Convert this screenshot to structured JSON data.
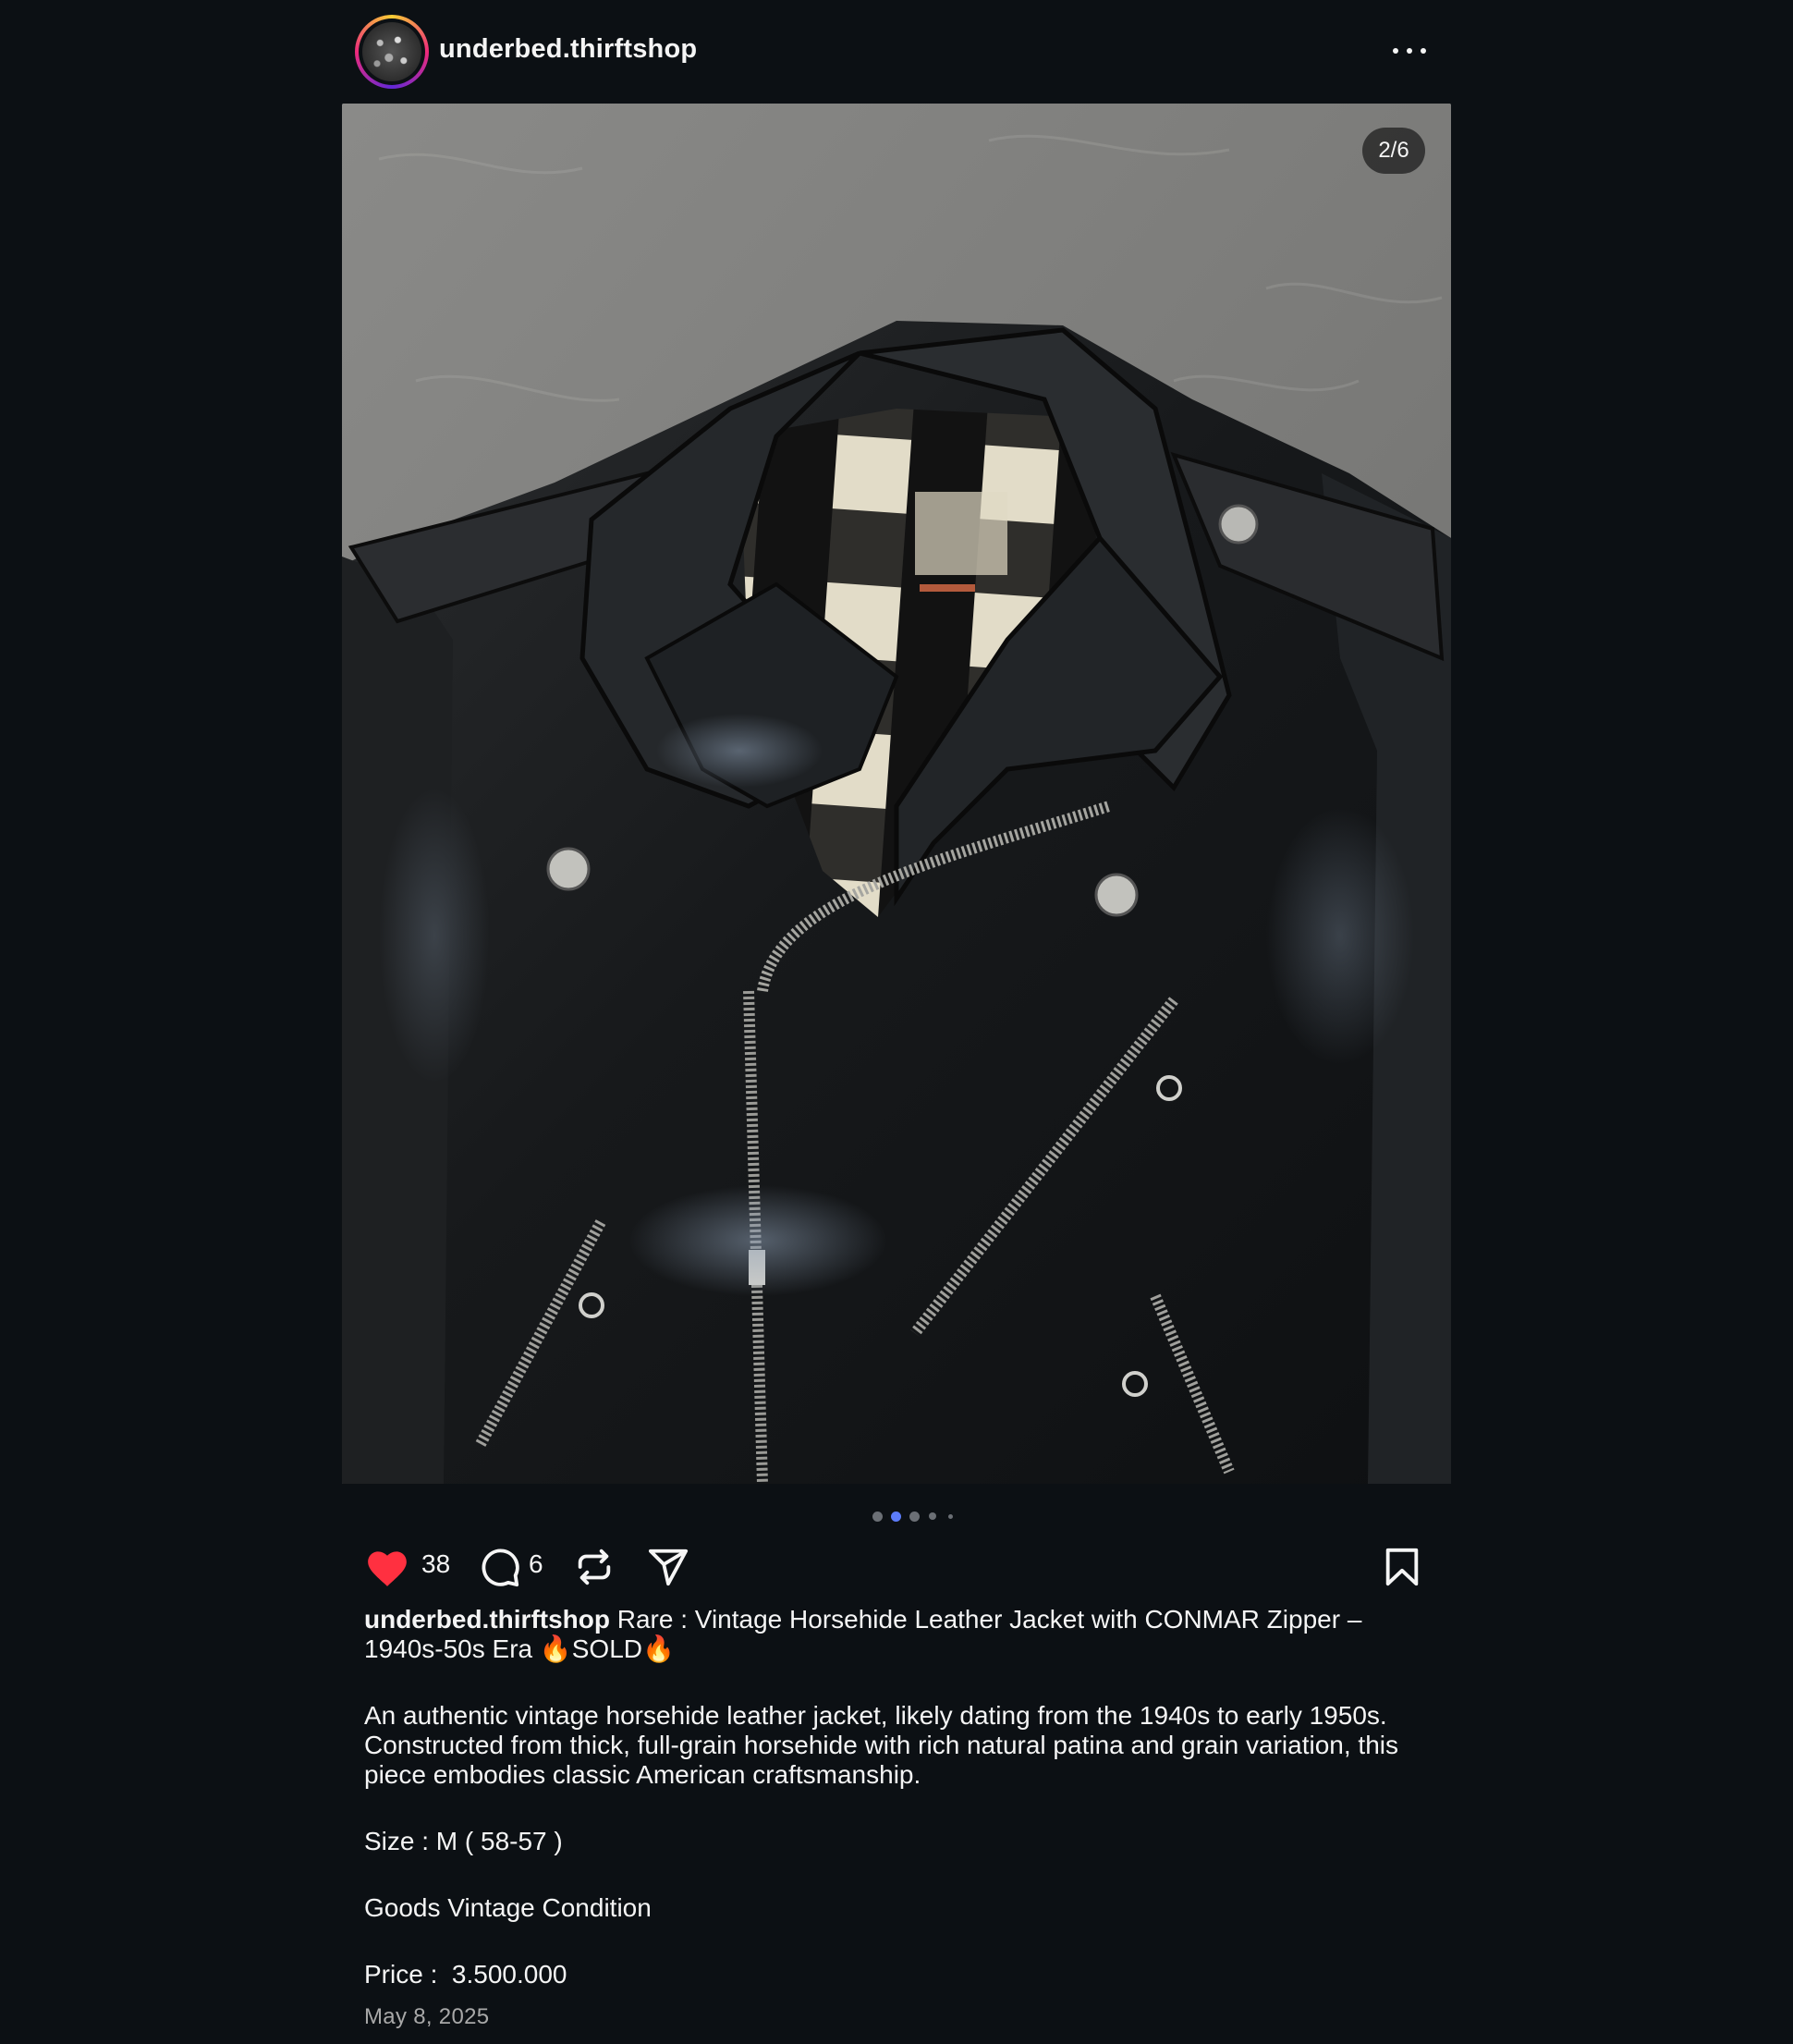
{
  "post": {
    "username": "underbed.thirftshop",
    "more_icon": "more-horizontal-icon",
    "media_counter": "2/6",
    "carousel": {
      "count": 5,
      "active_index": 1
    },
    "likes": "38",
    "comments": "6",
    "liked": true,
    "colors": {
      "like": "#ff3040",
      "active_dot": "#5c7cfa",
      "background": "#0c1014"
    },
    "caption": {
      "author": "underbed.thirftshop",
      "title": "Rare : Vintage Horsehide Leather Jacket with CONMAR Zipper – 1940s-50s Era 🔥SOLD🔥",
      "description": "An authentic vintage horsehide leather jacket, likely dating from the 1940s to early 1950s. Constructed from thick, full-grain horsehide with rich natural patina and grain variation, this piece embodies classic American craftsmanship.",
      "size": "Size : M ( 58-57 )",
      "condition": "Goods Vintage Condition",
      "price": "Price :  3.500.000"
    },
    "date": "May 8, 2025"
  }
}
